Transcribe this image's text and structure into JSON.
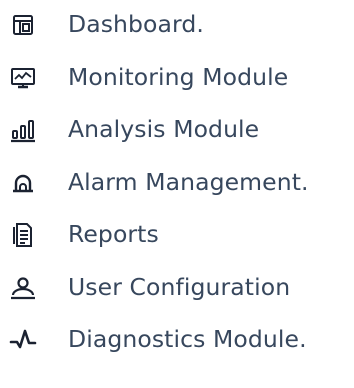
{
  "sidebar": {
    "items": [
      {
        "label": "Dashboard.",
        "icon": "dashboard-icon"
      },
      {
        "label": "Monitoring Module",
        "icon": "monitor-icon"
      },
      {
        "label": "Analysis Module",
        "icon": "bar-chart-icon"
      },
      {
        "label": "Alarm Management.",
        "icon": "alarm-bell-icon"
      },
      {
        "label": "Reports",
        "icon": "document-icon"
      },
      {
        "label": "User Configuration",
        "icon": "user-icon"
      },
      {
        "label": "Diagnostics Module.",
        "icon": "pulse-icon"
      }
    ]
  },
  "colors": {
    "text": "#37475d",
    "icon": "#1b2231",
    "background": "#ffffff"
  }
}
